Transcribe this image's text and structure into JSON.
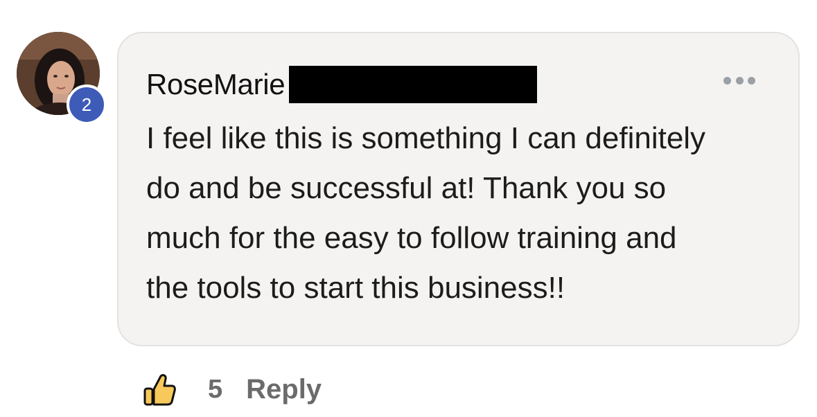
{
  "comment": {
    "author": "RoseMarie",
    "author_redacted": true,
    "avatar_badge": "2",
    "text": "I feel like this is something I can definitely\ndo and be successful at! Thank you so\nmuch for the easy to follow training and\nthe tools to start this business!!",
    "more_icon": "more-horizontal-icon"
  },
  "actions": {
    "like_icon": "thumbs-up-icon",
    "like_count": "5",
    "reply_label": "Reply"
  },
  "colors": {
    "badge": "#3e5bb8",
    "bubble": "#f4f3f2",
    "like_yellow": "#f7c85a",
    "muted_text": "#6b6b6b"
  }
}
